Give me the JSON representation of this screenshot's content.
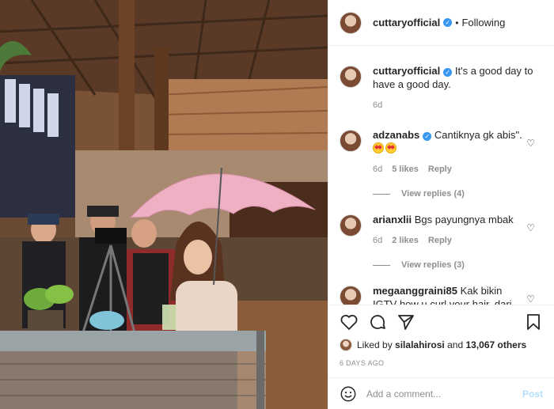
{
  "post": {
    "author": "cuttaryofficial",
    "follow_status": "Following",
    "separator": "•"
  },
  "comments": [
    {
      "username": "cuttaryofficial",
      "text": "It's a good day to have a good day.",
      "time": "6d",
      "is_caption": true
    },
    {
      "username": "adzanabs",
      "text": "Cantiknya gk abis\".",
      "time": "6d",
      "likes": "5 likes",
      "reply": "Reply",
      "view_replies": "View replies (4)"
    },
    {
      "username": "arianxlii",
      "text": "Bgs payungnya mbak",
      "time": "6d",
      "likes": "2 likes",
      "reply": "Reply",
      "view_replies": "View replies (3)"
    },
    {
      "username": "megaanggraini85",
      "text": "Kak bikin IGTV how u curl your hair, dari dulu"
    }
  ],
  "likes": {
    "prefix": "Liked by",
    "user": "silalahirosi",
    "and": "and",
    "count": "13,067 others"
  },
  "timestamp": "6 DAYS AGO",
  "comment_box": {
    "placeholder": "Add a comment...",
    "post_label": "Post"
  },
  "icons": {
    "like": "heart-icon",
    "comment": "comment-icon",
    "share": "share-icon",
    "save": "bookmark-icon",
    "emoji": "smiley-icon"
  },
  "colors": {
    "verified": "#3897f0",
    "muted": "#8e8e8e",
    "post_button": "#b2dffc"
  }
}
